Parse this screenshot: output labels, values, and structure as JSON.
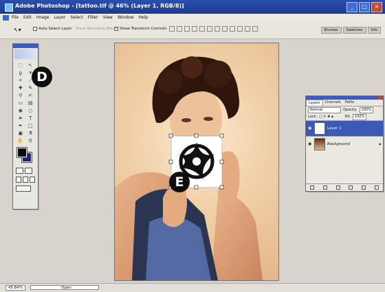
{
  "window": {
    "title": "Adobe Photoshop - [tattoo.tif @ 46% (Layer 1, RGB/8)]"
  },
  "menu": [
    "File",
    "Edit",
    "Image",
    "Layer",
    "Select",
    "Filter",
    "View",
    "Window",
    "Help"
  ],
  "options": {
    "auto_select_label": "Auto Select Layer",
    "auto_select_checked": false,
    "show_bounding_label": "Show Bounding Box",
    "show_transform_label": "Show Transform Controls",
    "show_transform_checked": true,
    "palette_tabs": [
      "Brushes",
      "Swatches",
      "Info"
    ]
  },
  "callouts": {
    "d": "D",
    "e": "E"
  },
  "layers_panel": {
    "tabs": [
      "Layers",
      "Channels",
      "Paths"
    ],
    "blend_mode": "Normal",
    "opacity_label": "Opacity:",
    "opacity_value": "100%",
    "lock_label": "Lock:",
    "fill_label": "Fill:",
    "fill_value": "100%",
    "layers": [
      {
        "name": "Layer 1",
        "selected": true
      },
      {
        "name": "Background",
        "selected": false
      }
    ]
  },
  "status": {
    "zoom": "45.84%",
    "doc": "Open"
  },
  "colors": {
    "foreground": "#0c0c0c",
    "background": "#22227a",
    "accent": "#3a5dc0"
  }
}
